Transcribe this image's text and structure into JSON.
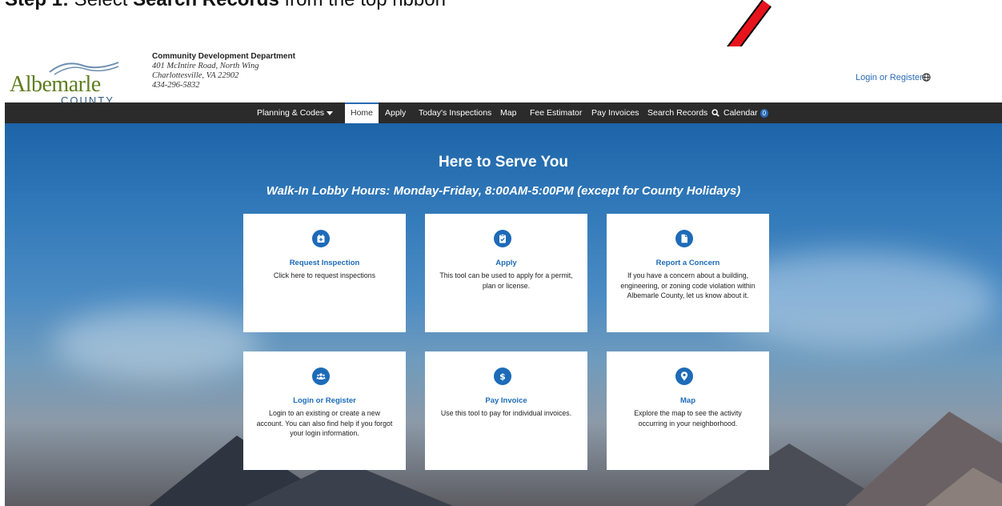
{
  "instruction": {
    "prefix": "Step 1:",
    "middle": " Select ",
    "target": "Search Records",
    "suffix": " from the top ribbon"
  },
  "header": {
    "logo_word": "Albemarle",
    "logo_county": "COUNTY",
    "department_name": "Community Development Department",
    "address_line1": "401 McIntire Road, North Wing",
    "address_line2": "Charlottesville, VA 22902",
    "phone": "434-296-5832",
    "login_link": "Login or Register",
    "globe_icon": "globe-icon"
  },
  "nav": {
    "items": [
      {
        "label": "Planning & Codes",
        "has_caret": true
      },
      {
        "label": "Home",
        "active": true
      },
      {
        "label": "Apply"
      },
      {
        "label": "Today's Inspections"
      },
      {
        "label": "Map"
      },
      {
        "label": "Fee Estimator"
      },
      {
        "label": "Pay Invoices"
      },
      {
        "label": "Search Records",
        "icon": "search-icon"
      },
      {
        "label": "Calendar",
        "badge": "0"
      }
    ]
  },
  "hero": {
    "title": "Here to Serve You",
    "subtitle": "Walk-In Lobby Hours: Monday-Friday, 8:00AM-5:00PM (except for County Holidays)"
  },
  "cards": [
    {
      "title": "Request Inspection",
      "desc": "Click here to request inspections",
      "icon": "calendar-plus-icon"
    },
    {
      "title": "Apply",
      "desc": "This tool can be used to apply for a permit, plan or license.",
      "icon": "clipboard-check-icon"
    },
    {
      "title": "Report a Concern",
      "desc": "If you have a concern about a building, engineering, or zoning code violation within Albemarle County, let us know about it.",
      "icon": "document-icon"
    },
    {
      "title": "Login or Register",
      "desc": "Login to an existing or create a new account. You can also find help if you forgot your login information.",
      "icon": "users-icon"
    },
    {
      "title": "Pay Invoice",
      "desc": "Use this tool to pay for individual invoices.",
      "icon": "dollar-icon"
    },
    {
      "title": "Map",
      "desc": "Explore the map to see the activity occurring in your neighborhood.",
      "icon": "map-pin-icon"
    }
  ],
  "colors": {
    "brand_blue": "#1d6bb8",
    "nav_bg": "#2b2b2b",
    "logo_green": "#5f7d1f",
    "annotation_arrow": "#e8141c"
  }
}
